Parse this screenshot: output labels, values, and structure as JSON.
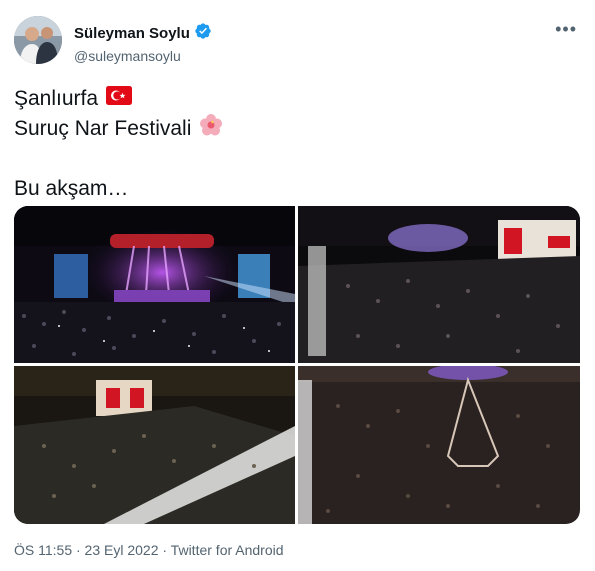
{
  "author": {
    "name": "Süleyman Soylu",
    "handle": "@suleymansoylu",
    "verified": true
  },
  "tweet": {
    "line1": "Şanlıurfa",
    "line1_emoji": "turkey-flag",
    "line2": "Suruç Nar Festivali",
    "line2_emoji": "hibiscus",
    "line3": "Bu akşam…"
  },
  "meta": "ÖS 11:55 · 23 Eyl 2022 · Twitter for Android",
  "colors": {
    "verified": "#1d9bf0",
    "text": "#0f1419",
    "secondary": "#536471",
    "flag_red": "#e30a17"
  }
}
